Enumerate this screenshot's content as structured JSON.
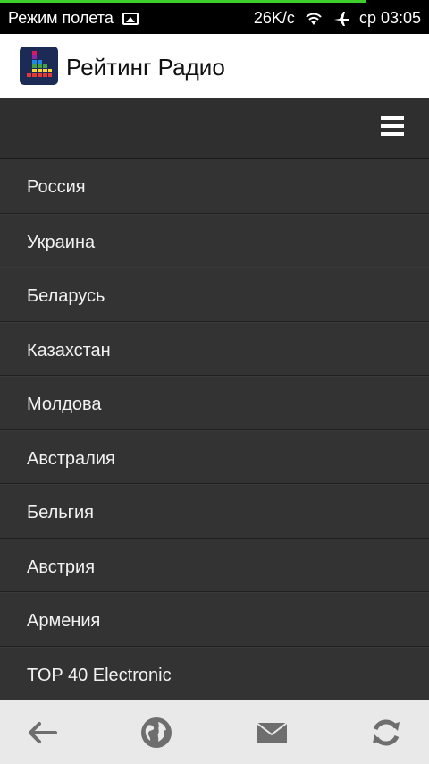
{
  "status_bar": {
    "mode_text": "Режим полета",
    "speed": "26K/c",
    "time": "ср 03:05"
  },
  "app": {
    "title": "Рейтинг Радио"
  },
  "countries": [
    "Россия",
    "Украина",
    "Беларусь",
    "Казахстан",
    "Молдова",
    "Австралия",
    "Бельгия",
    "Австрия",
    "Армения",
    "TOP 40 Electronic"
  ],
  "colors": {
    "accent_progress": "#3fcf2a",
    "list_bg": "#333333",
    "app_bar_bg": "#ffffff"
  },
  "icons": {
    "top": [
      "menu-icon"
    ],
    "bottom": [
      "back-arrow-icon",
      "globe-icon",
      "mail-icon",
      "refresh-icon"
    ]
  }
}
